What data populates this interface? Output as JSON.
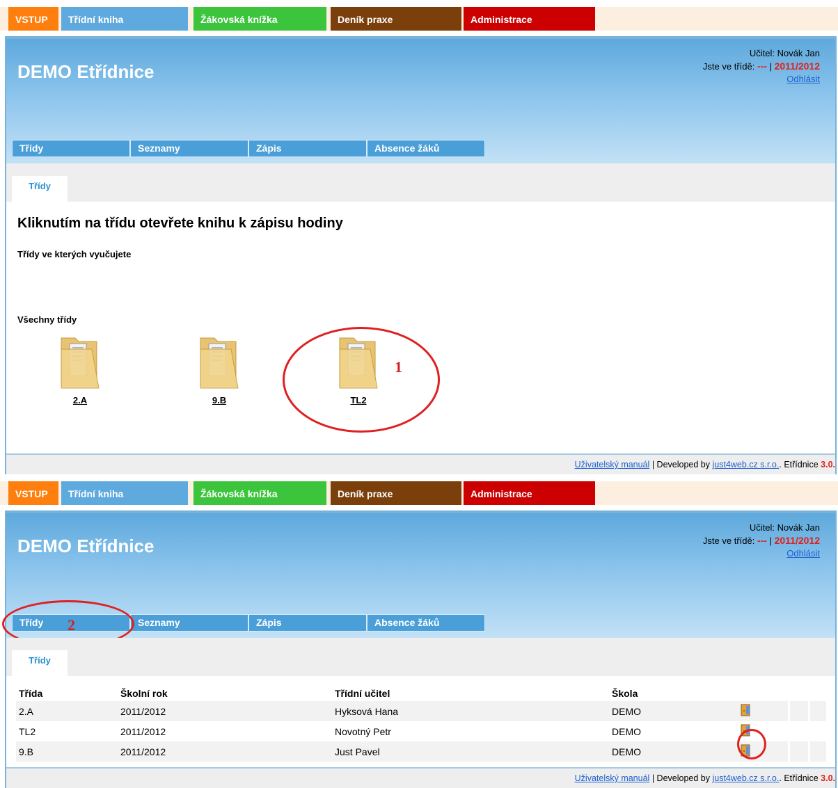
{
  "app_tabs": [
    {
      "label": "VSTUP",
      "color": "#ff7f0e"
    },
    {
      "label": "Třídní kniha",
      "color": "#5ea9dd"
    },
    {
      "label": "Žákovská knížka",
      "color": "#3cc43c"
    },
    {
      "label": "Deník praxe",
      "color": "#7a3f0b"
    },
    {
      "label": "Administrace",
      "color": "#cc0000"
    }
  ],
  "header": {
    "title": "DEMO Etřídnice",
    "teacher": "Učitel: Novák Jan",
    "class_label": "Jste ve třídě:",
    "class_value": "---",
    "separator": "|",
    "year": "2011/2012",
    "logout": "Odhlásit"
  },
  "nav": [
    "Třídy",
    "Seznamy",
    "Zápis",
    "Absence žáků"
  ],
  "subtab": "Třídy",
  "screen1": {
    "heading": "Kliknutím na třídu otevřete knihu k zápisu hodiny",
    "taught_label": "Třídy ve kterých vyučujete",
    "all_label": "Všechny třídy",
    "folders": [
      "2.A",
      "9.B",
      "TL2"
    ],
    "annotation": "1"
  },
  "screen2": {
    "annotation": "2",
    "columns": [
      "Třída",
      "Školní rok",
      "Třídní učitel",
      "Škola"
    ],
    "rows": [
      {
        "class": "2.A",
        "year": "2011/2012",
        "teacher": "Hyksová Hana",
        "school": "DEMO"
      },
      {
        "class": "TL2",
        "year": "2011/2012",
        "teacher": "Novotný Petr",
        "school": "DEMO"
      },
      {
        "class": "9.B",
        "year": "2011/2012",
        "teacher": "Just Pavel",
        "school": "DEMO"
      }
    ]
  },
  "footer": {
    "manual": "Uživatelský manuál",
    "sep": "|",
    "developed": "Developed by",
    "company": "just4web.cz s.r.o.",
    "product": "Etřídnice",
    "version": "3.0."
  },
  "icons": {
    "folder": "folder-icon",
    "door": "door-icon"
  }
}
